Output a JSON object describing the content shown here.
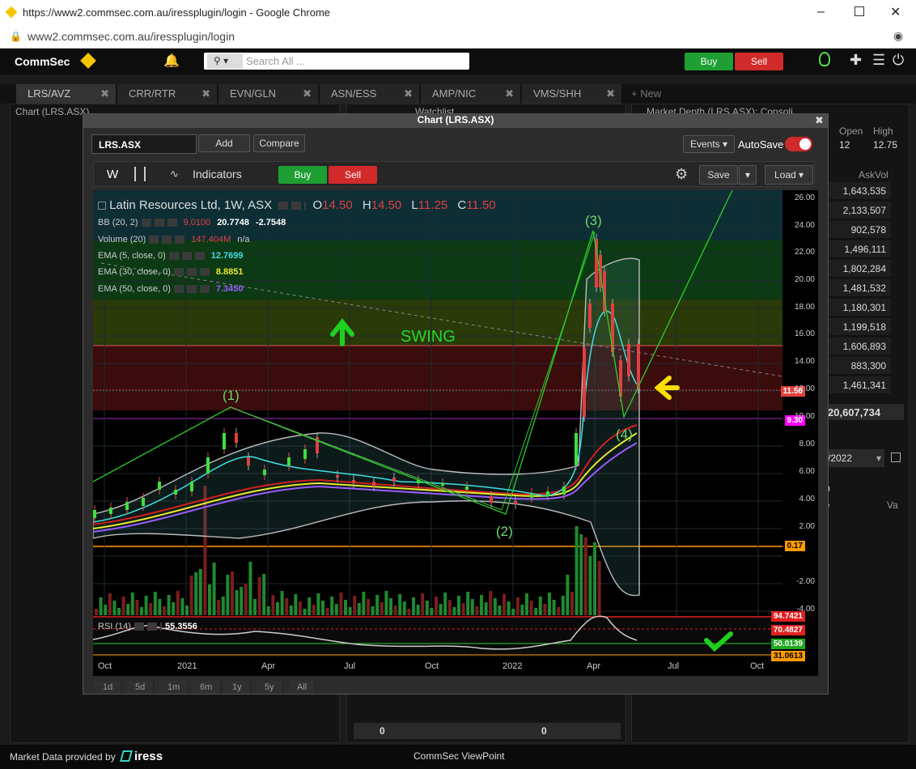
{
  "browser": {
    "url_title": "https://www2.commsec.com.au/iressplugin/login - Google Chrome",
    "address": "www2.commsec.com.au/iressplugin/login"
  },
  "header": {
    "logo": "CommSec",
    "search_placeholder": "Search All ...",
    "buy": "Buy",
    "sell": "Sell"
  },
  "ws_tabs": [
    "LRS/AVZ",
    "CRR/RTR",
    "EVN/GLN",
    "ASN/ESS",
    "AMP/NIC",
    "VMS/SHH"
  ],
  "new_tab": "+ New",
  "panels": {
    "chart_bg": "Chart (LRS.ASX)",
    "watchlist": "Watchlist",
    "depth": "Market Depth (LRS.ASX): Consoli..."
  },
  "depth": {
    "open_label": "Open",
    "high_label": "High",
    "open": "12",
    "high": "12.75",
    "askvol_label": "AskVol",
    "askvols": [
      "1,643,535",
      "2,133,507",
      "902,578",
      "1,496,111",
      "1,802,284",
      "1,481,532",
      "1,180,301",
      "1,199,518",
      "1,606,893",
      "883,300",
      "1,461,341"
    ],
    "total": "20,607,734",
    "date": "/2022",
    "partial1": "e",
    "partial2": "Va",
    "partial3": "0"
  },
  "chart_window": {
    "title": "Chart (LRS.ASX)",
    "symbol": "LRS.ASX",
    "add": "Add",
    "compare": "Compare",
    "events": "Events",
    "autosave": "AutoSave",
    "period": "W",
    "indicators": "Indicators",
    "buy": "Buy",
    "sell": "Sell",
    "save": "Save",
    "load": "Load"
  },
  "legend": {
    "name": "Latin Resources Ltd, 1W, ASX",
    "o_label": "O",
    "o": "14.50",
    "h_label": "H",
    "h": "14.50",
    "l_label": "L",
    "l": "11.25",
    "c_label": "C",
    "c": "11.50",
    "bb": "BB (20, 2)",
    "bb_v1": "9.0100",
    "bb_v2": "20.7748",
    "bb_v3": "-2.7548",
    "vol": "Volume (20)",
    "vol_v": "147.404M",
    "vol_v2": "n/a",
    "ema5": "EMA (5, close, 0)",
    "ema5_v": "12.7699",
    "ema30": "EMA (30, close, 0)",
    "ema30_v": "8.8851",
    "ema50": "EMA (50, close, 0)",
    "ema50_v": "7.3450",
    "rsi": "RSI (14)",
    "rsi_v": "55.3556"
  },
  "annotations": {
    "swing": "SWING",
    "w1": "(1)",
    "w2": "(2)",
    "w3": "(3)",
    "w4": "(4)"
  },
  "price_tags": {
    "last": "11.50",
    "p930": "9.30",
    "p017": "0.17",
    "r1": "94.7421",
    "r2": "70.4827",
    "r3": "50.0139",
    "r4": "31.0613"
  },
  "yaxis": [
    "26.00",
    "24.00",
    "22.00",
    "20.00",
    "18.00",
    "16.00",
    "14.00",
    "12.00",
    "10.00",
    "8.00",
    "6.00",
    "4.00",
    "2.00",
    "-2.00",
    "-4.00"
  ],
  "xaxis": [
    "Oct",
    "2021",
    "Apr",
    "Jul",
    "Oct",
    "2022",
    "Apr",
    "Jul",
    "Oct"
  ],
  "ranges": [
    "1d",
    "5d",
    "1m",
    "6m",
    "1y",
    "5y",
    "All"
  ],
  "bottom": {
    "v1": "0",
    "v2": "0"
  },
  "footer": {
    "provided": "Market Data provided by",
    "brand": "iress",
    "app": "CommSec ViewPoint"
  },
  "colors": {
    "buy": "#1e9e33",
    "sell": "#d12a2a",
    "accent": "#f7c500"
  }
}
